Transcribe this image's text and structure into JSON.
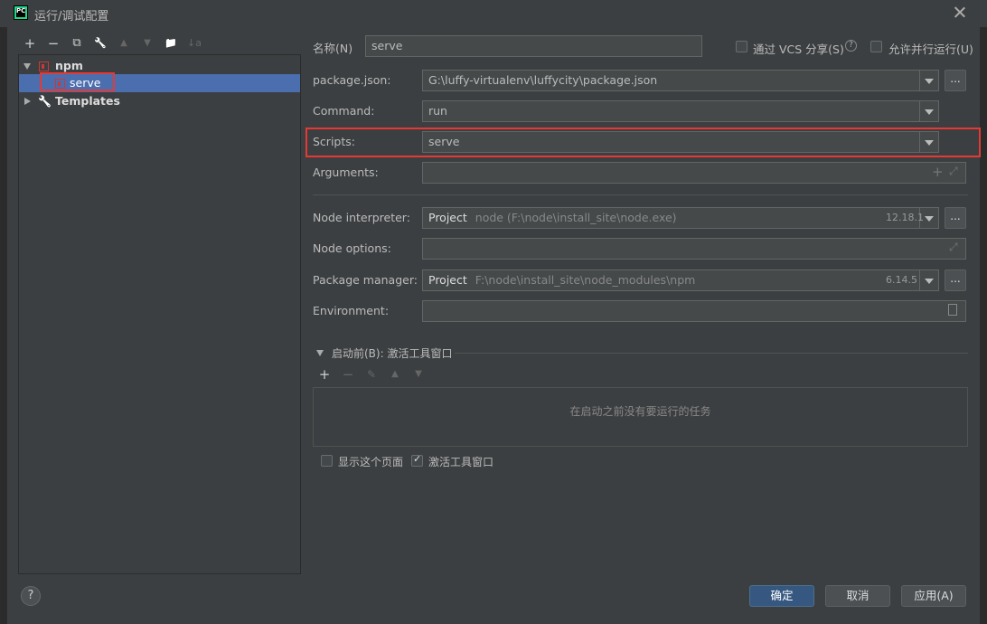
{
  "window": {
    "app_icon_text": "PC",
    "title": "运行/调试配置"
  },
  "toolbar": {
    "add": "+",
    "remove": "−",
    "copy": "⧉",
    "edit": "🔧",
    "move_up": "▲",
    "move_down": "▼",
    "folder": "📁",
    "sort": "↓a"
  },
  "tree": {
    "npm_label": "npm",
    "serve_label": "serve",
    "templates_label": "Templates"
  },
  "form": {
    "name_label": "名称(N)",
    "name_value": "serve",
    "share_vcs_label": "通过 VCS 分享(S)",
    "allow_parallel_label": "允许并行运行(U)",
    "package_json_label": "package.json:",
    "package_json_value": "G:\\luffy-virtualenv\\luffycity\\package.json",
    "command_label": "Command:",
    "command_value": "run",
    "scripts_label": "Scripts:",
    "scripts_value": "serve",
    "arguments_label": "Arguments:",
    "arguments_value": "",
    "node_interpreter_label": "Node interpreter:",
    "node_interpreter_prefix": "Project",
    "node_interpreter_value": "node (F:\\node\\install_site\\node.exe)",
    "node_version": "12.18.1",
    "node_options_label": "Node options:",
    "node_options_value": "",
    "package_manager_label": "Package manager:",
    "package_manager_prefix": "Project",
    "package_manager_value": "F:\\node\\install_site\\node_modules\\npm",
    "package_manager_version": "6.14.5",
    "environment_label": "Environment:",
    "environment_value": "",
    "ellipsis": "..."
  },
  "before_launch": {
    "title": "启动前(B): 激活工具窗口",
    "empty_text": "在启动之前没有要运行的任务",
    "show_page_label": "显示这个页面",
    "activate_tool_label": "激活工具窗口",
    "activate_tool_checked": true,
    "show_page_checked": false
  },
  "buttons": {
    "ok": "确定",
    "cancel": "取消",
    "apply": "应用(A)",
    "help": "?"
  }
}
